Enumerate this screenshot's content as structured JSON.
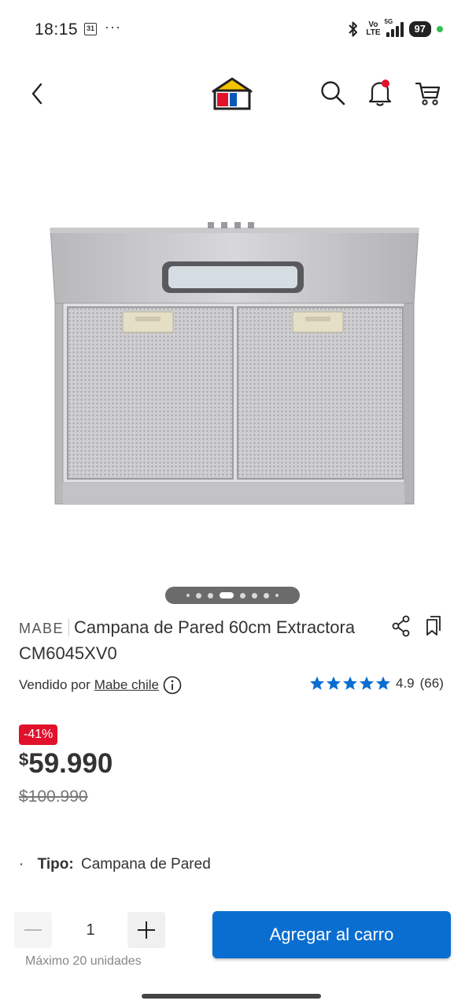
{
  "status_bar": {
    "time": "18:15",
    "calendar_day": "31",
    "overflow": "···",
    "volte_top": "Vo",
    "volte_bottom": "LTE",
    "network": "5G",
    "battery": "97"
  },
  "header": {
    "logo": "sodimac-house-logo",
    "icons": [
      "back-icon",
      "search-icon",
      "bell-icon",
      "cart-icon"
    ],
    "notification_dot_color": "#e1112c"
  },
  "gallery": {
    "image": "stainless steel wall range hood",
    "carousel_position": "4 of 8"
  },
  "product": {
    "brand": "MABE",
    "title": "Campana de Pared 60cm Extractora CM6045XV0",
    "seller_prefix": "Vendido por",
    "seller_name": "Mabe chile",
    "rating": "4.9",
    "rating_count": "(66)",
    "stars": 5
  },
  "price": {
    "discount": "-41%",
    "currency": "$",
    "current": "59.990",
    "original": "100.990"
  },
  "specs": [
    {
      "bullet": "·",
      "key": "Tipo:",
      "value": "Campana de Pared"
    }
  ],
  "purchase": {
    "quantity": "1",
    "max_units": "Máximo 20 unidades",
    "add_to_cart": "Agregar al carro"
  },
  "colors": {
    "primary_blue": "#0a6ed1",
    "discount_red": "#e1112c",
    "star_blue": "#0a6ed1"
  }
}
